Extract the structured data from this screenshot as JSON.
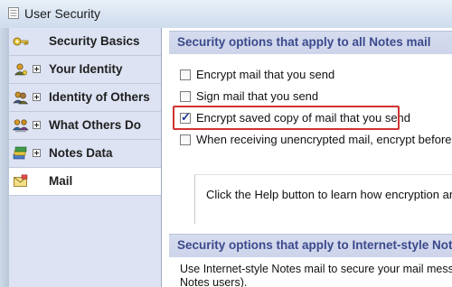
{
  "window": {
    "title": "User Security"
  },
  "sidebar": {
    "items": [
      {
        "label": "Security Basics",
        "icon": "key-icon",
        "expandable": false,
        "selected": false
      },
      {
        "label": "Your Identity",
        "icon": "identity-icon",
        "expandable": true,
        "selected": false
      },
      {
        "label": "Identity of Others",
        "icon": "others-identity-icon",
        "expandable": true,
        "selected": false
      },
      {
        "label": "What Others Do",
        "icon": "people-icon",
        "expandable": true,
        "selected": false
      },
      {
        "label": "Notes Data",
        "icon": "notes-data-icon",
        "expandable": true,
        "selected": false
      },
      {
        "label": "Mail",
        "icon": "mail-icon",
        "expandable": false,
        "selected": true
      }
    ]
  },
  "main": {
    "section1": {
      "title": "Security options that apply to all Notes mail",
      "options": [
        {
          "label": "Encrypt mail that you send",
          "mnemonic": "E",
          "checked": false
        },
        {
          "label": "Sign mail that you send",
          "mnemonic": "S",
          "checked": false
        },
        {
          "label": "Encrypt saved copy of mail that you send",
          "mnemonic": "E",
          "checked": true
        },
        {
          "label": "When receiving unencrypted mail, encrypt before sto",
          "mnemonic": "u",
          "checked": false
        }
      ],
      "help_text": "Click the Help button to learn how encryption and s"
    },
    "section2": {
      "title": "Security options that apply to Internet-style Not",
      "paragraph_line1": "Use Internet-style Notes mail to secure your mail messag",
      "paragraph_line2": "Notes users)."
    }
  },
  "colors": {
    "highlight": "#d13232",
    "section_header_text": "#3b4a8c",
    "sidebar_bg": "#dde3f3"
  }
}
